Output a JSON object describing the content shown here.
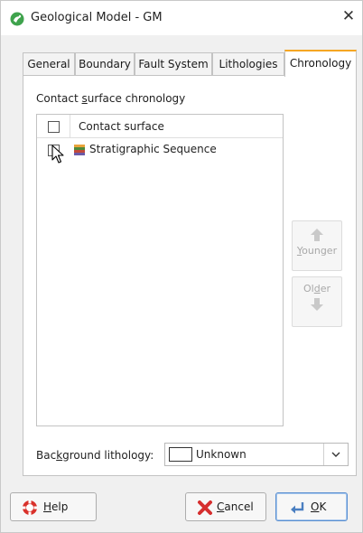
{
  "window": {
    "title": "Geological Model - GM",
    "close_glyph": "✕",
    "app_icon": "leapfrog-icon"
  },
  "tabs": [
    {
      "label": "General",
      "active": false
    },
    {
      "label": "Boundary",
      "active": false
    },
    {
      "label": "Fault System",
      "active": false
    },
    {
      "label": "Lithologies",
      "active": false
    },
    {
      "label": "Chronology",
      "active": true
    }
  ],
  "chronology": {
    "group_label_pre": "Contact ",
    "group_label_mnemonic": "s",
    "group_label_post": "urface chronology",
    "list": {
      "header": "Contact surface",
      "header_checked": false,
      "rows": [
        {
          "label": "Stratigraphic Sequence",
          "checked": false,
          "icon": "stratigraphic-sequence-icon"
        }
      ]
    },
    "younger_button": {
      "mnemonic": "Y",
      "rest": "ounger",
      "enabled": false,
      "icon": "arrow-up-icon"
    },
    "older_button": {
      "pre": "Ol",
      "mnemonic": "d",
      "post": "er",
      "enabled": false,
      "icon": "arrow-down-icon"
    },
    "background": {
      "label_pre": "Bac",
      "label_mnemonic": "k",
      "label_post": "ground lithology:",
      "value": "Unknown",
      "swatch_color": "#ffffff"
    }
  },
  "footer": {
    "help": {
      "mnemonic": "H",
      "rest": "elp",
      "icon": "help-icon"
    },
    "cancel": {
      "mnemonic": "C",
      "rest": "ancel",
      "icon": "cancel-icon"
    },
    "ok": {
      "mnemonic": "O",
      "rest": "K",
      "icon": "ok-icon"
    }
  },
  "colors": {
    "active_tab_accent": "#f5a623",
    "panel_bg": "#f0f0f0",
    "disabled_text": "#a8a8a8"
  }
}
